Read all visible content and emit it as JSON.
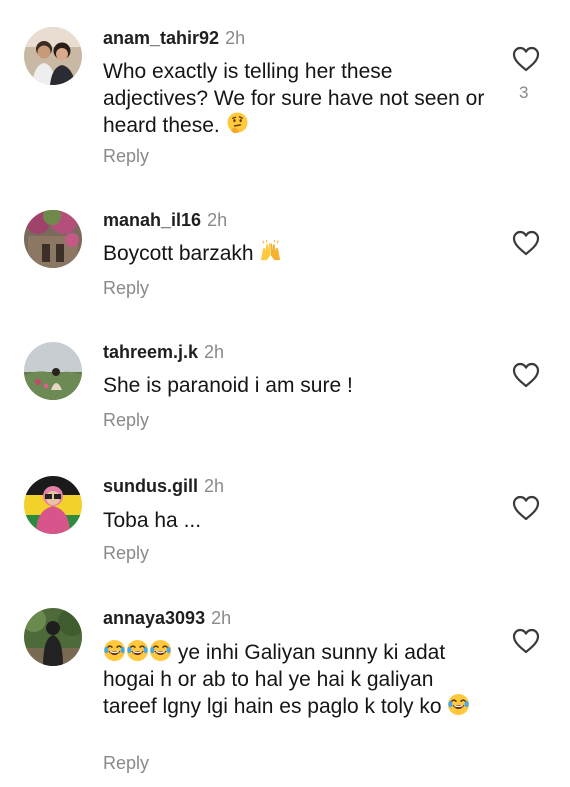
{
  "comments": [
    {
      "username": "anam_tahir92",
      "time": "2h",
      "text": "Who exactly is telling her these adjectives? We for sure have not seen or heard these.",
      "emoji": "thinking-face",
      "reply": "Reply",
      "likes": "3"
    },
    {
      "username": "manah_il16",
      "time": "2h",
      "text": "Boycott barzakh",
      "emoji": "raising-hands",
      "reply": "Reply"
    },
    {
      "username": "tahreem.j.k",
      "time": "2h",
      "text": "She is paranoid i am sure !",
      "reply": "Reply"
    },
    {
      "username": "sundus.gill",
      "time": "2h",
      "text": "Toba ha ...",
      "reply": "Reply"
    },
    {
      "username": "annaya3093",
      "time": "2h",
      "text_part1": " ye inhi Galiyan sunny ki adat hogai h or ab to hal ye hai k galiyan tareef lgny lgi hain es paglo k toly ko",
      "emoji": "face-with-tears-of-joy",
      "reply": "Reply"
    }
  ],
  "icons": {
    "like": "heart-outline-icon"
  },
  "colors": {
    "secondary_text": "#8a8a8a",
    "primary_text": "#151515"
  }
}
